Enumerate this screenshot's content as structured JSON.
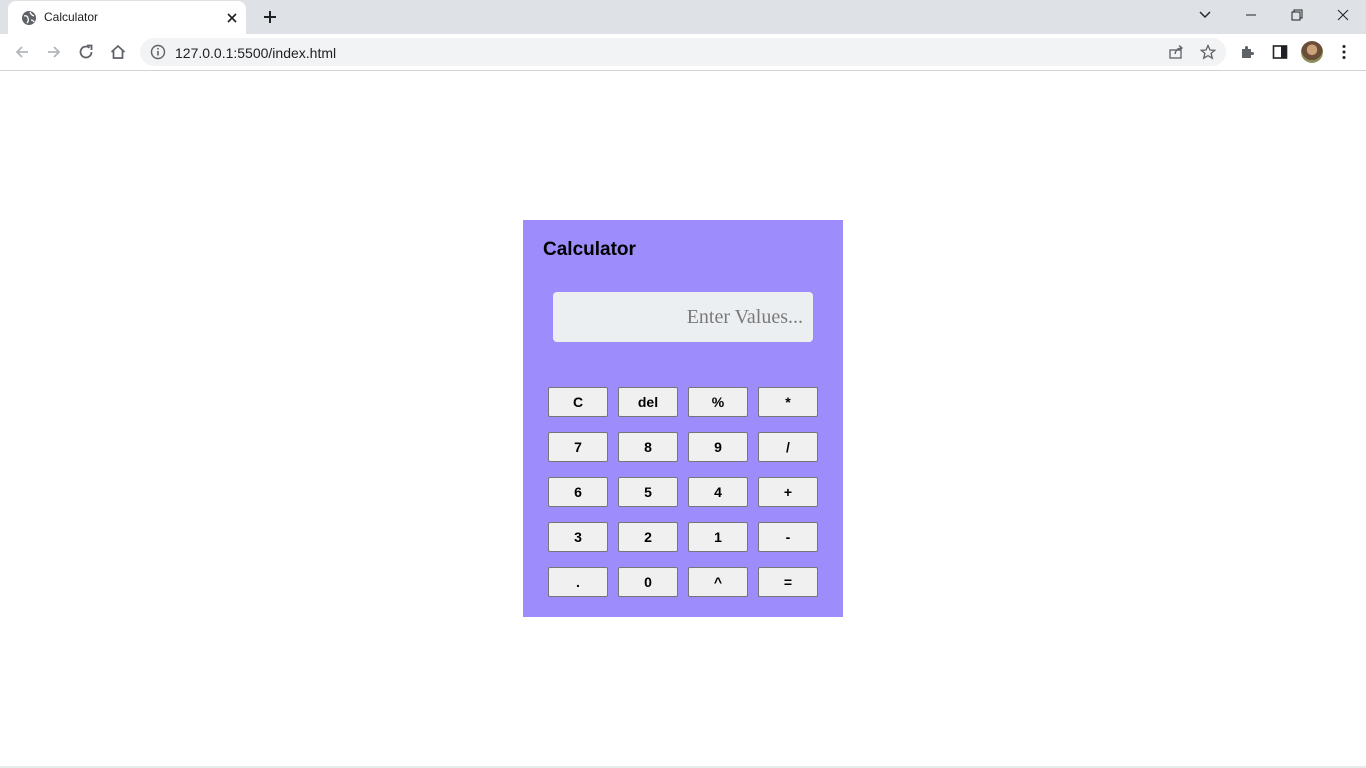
{
  "browser": {
    "tab_title": "Calculator",
    "url": "127.0.0.1:5500/index.html"
  },
  "calculator": {
    "title": "Calculator",
    "display_value": "",
    "display_placeholder": "Enter Values...",
    "keys": [
      [
        "C",
        "del",
        "%",
        "*"
      ],
      [
        "7",
        "8",
        "9",
        "/"
      ],
      [
        "6",
        "5",
        "4",
        "+"
      ],
      [
        "3",
        "2",
        "1",
        "-"
      ],
      [
        ".",
        "0",
        "^",
        "="
      ]
    ]
  },
  "colors": {
    "calculator_bg": "#9d8cfb",
    "display_bg": "#eceff2",
    "key_bg": "#f0f0f0"
  }
}
